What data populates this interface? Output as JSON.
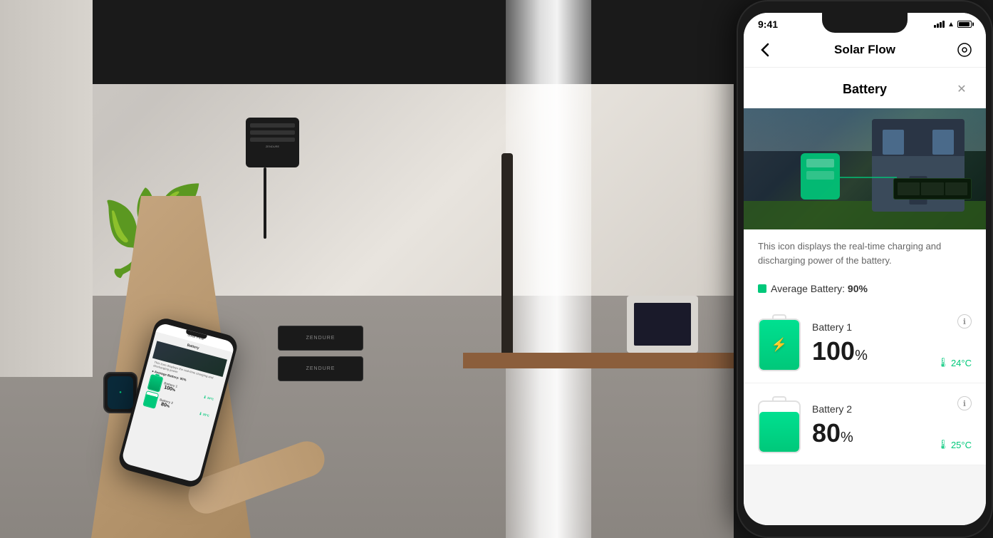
{
  "scene": {
    "background_color": "#1a1a1a"
  },
  "status_bar": {
    "time": "9:41",
    "signal_label": "signal",
    "wifi_label": "wifi",
    "battery_label": "battery"
  },
  "app_header": {
    "title": "Solar Flow",
    "back_label": "‹",
    "settings_label": "⊙"
  },
  "battery_modal": {
    "title": "Battery",
    "close_label": "✕",
    "description": "This icon displays the real-time charging and discharging power of the battery.",
    "average_label": "Average Battery:",
    "average_value": "90%",
    "batteries": [
      {
        "name": "Battery 1",
        "percentage": "100",
        "fill": 100,
        "temp": "24°C",
        "color": "#00c87a"
      },
      {
        "name": "Battery 2",
        "percentage": "80",
        "fill": 80,
        "temp": "25°C",
        "color": "#00c87a"
      }
    ]
  },
  "small_phone": {
    "header": "Solar Flow",
    "battery_section_title": "Battery",
    "average_label": "Average Battery: 90%",
    "batteries": [
      {
        "name": "Battery 1",
        "percentage": "100%"
      },
      {
        "name": "Battery 2",
        "percentage": "80%"
      }
    ]
  }
}
